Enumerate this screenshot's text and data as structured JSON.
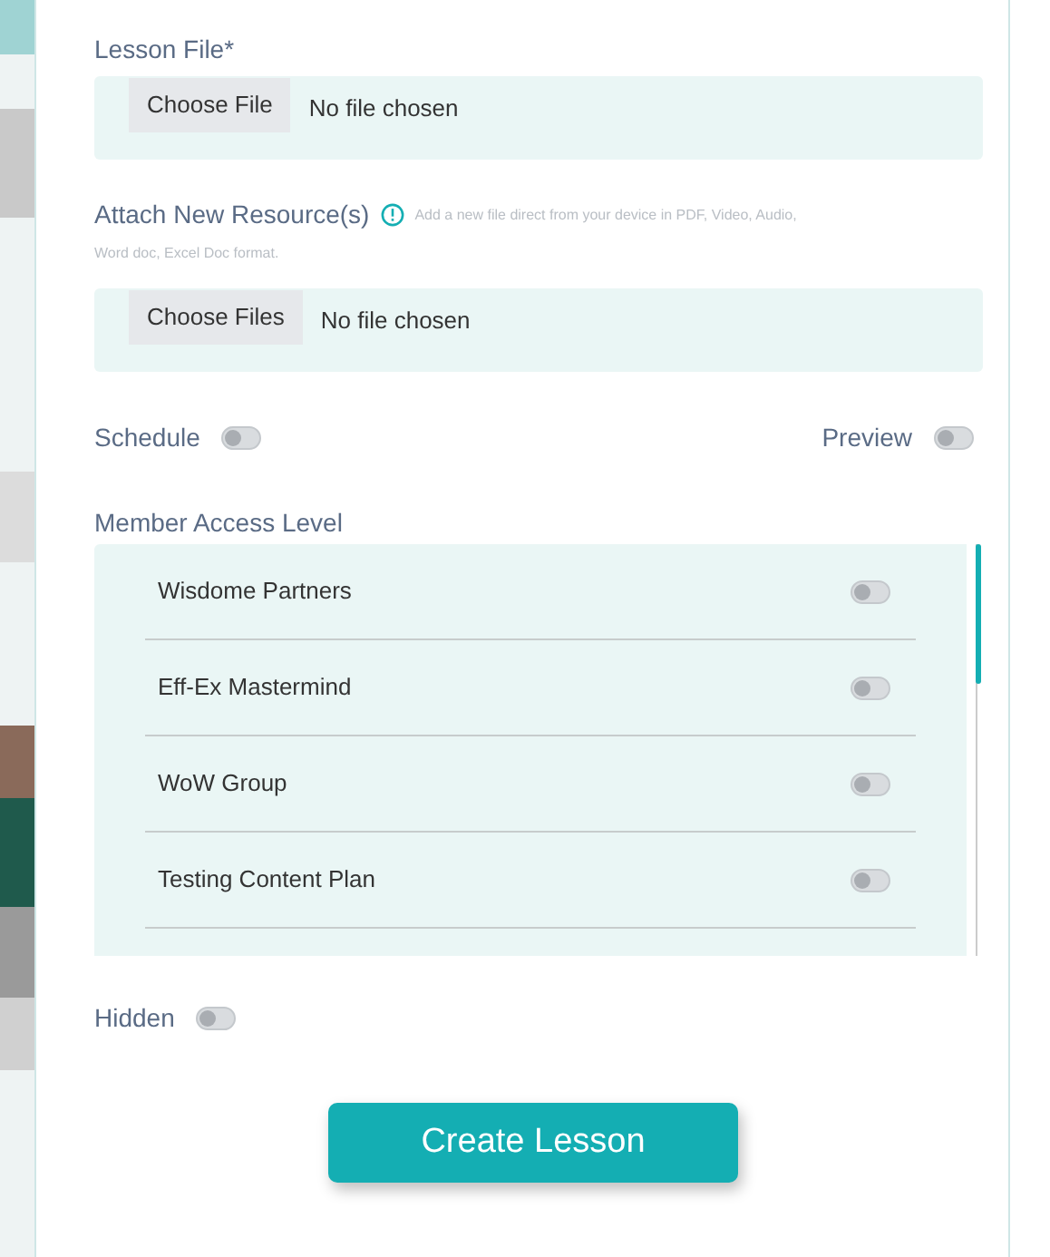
{
  "lesson_file": {
    "label": "Lesson File*",
    "button": "Choose File",
    "status": "No file chosen"
  },
  "resources": {
    "label": "Attach New Resource(s)",
    "hint_lines": [
      "Add a new file direct from your device in PDF, Video, Audio,",
      "Word doc, Excel Doc format."
    ],
    "button": "Choose Files",
    "status": "No file chosen"
  },
  "schedule": {
    "label": "Schedule",
    "on": false
  },
  "preview": {
    "label": "Preview",
    "on": false
  },
  "member_access": {
    "label": "Member Access Level",
    "items": [
      {
        "name": "Wisdome Partners",
        "on": false
      },
      {
        "name": "Eff-Ex Mastermind",
        "on": false
      },
      {
        "name": "WoW Group",
        "on": false
      },
      {
        "name": "Testing Content Plan",
        "on": false
      }
    ]
  },
  "hidden": {
    "label": "Hidden",
    "on": false
  },
  "submit": "Create Lesson"
}
